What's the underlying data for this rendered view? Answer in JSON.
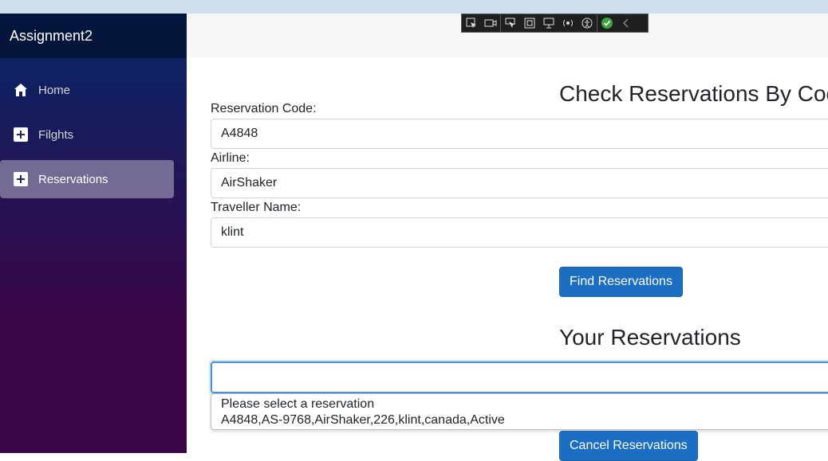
{
  "sidebar": {
    "brand": "Assignment2",
    "items": [
      {
        "label": "Home",
        "icon": "home-icon",
        "active": false
      },
      {
        "label": "Filghts",
        "icon": "plus-icon",
        "active": false
      },
      {
        "label": "Reservations",
        "icon": "plus-icon",
        "active": true
      }
    ]
  },
  "devtools": {
    "icons": [
      "select-element-icon",
      "video-icon",
      "pointer-icon",
      "frame-icon",
      "screen-icon",
      "broadcast-icon",
      "accessibility-icon",
      "check-icon",
      "chevron-left-icon"
    ]
  },
  "main": {
    "title": "Check Reservations By Code",
    "fields": {
      "code_label": "Reservation Code:",
      "code_value": "A4848",
      "airline_label": "Airline:",
      "airline_value": "AirShaker",
      "traveller_label": "Traveller Name:",
      "traveller_value": "klint"
    },
    "find_button": "Find Reservations",
    "your_title": "Your Reservations",
    "select": {
      "options": [
        "Please select a reservation",
        "A4848,AS-9768,AirShaker,226,klint,canada,Active"
      ]
    },
    "cancel_button": "Cancel Reservations"
  },
  "colors": {
    "accent": "#1b6ec2",
    "sidebar_top": "#052767",
    "sidebar_bottom": "#3a0647",
    "focus_border": "#4a90d9"
  }
}
